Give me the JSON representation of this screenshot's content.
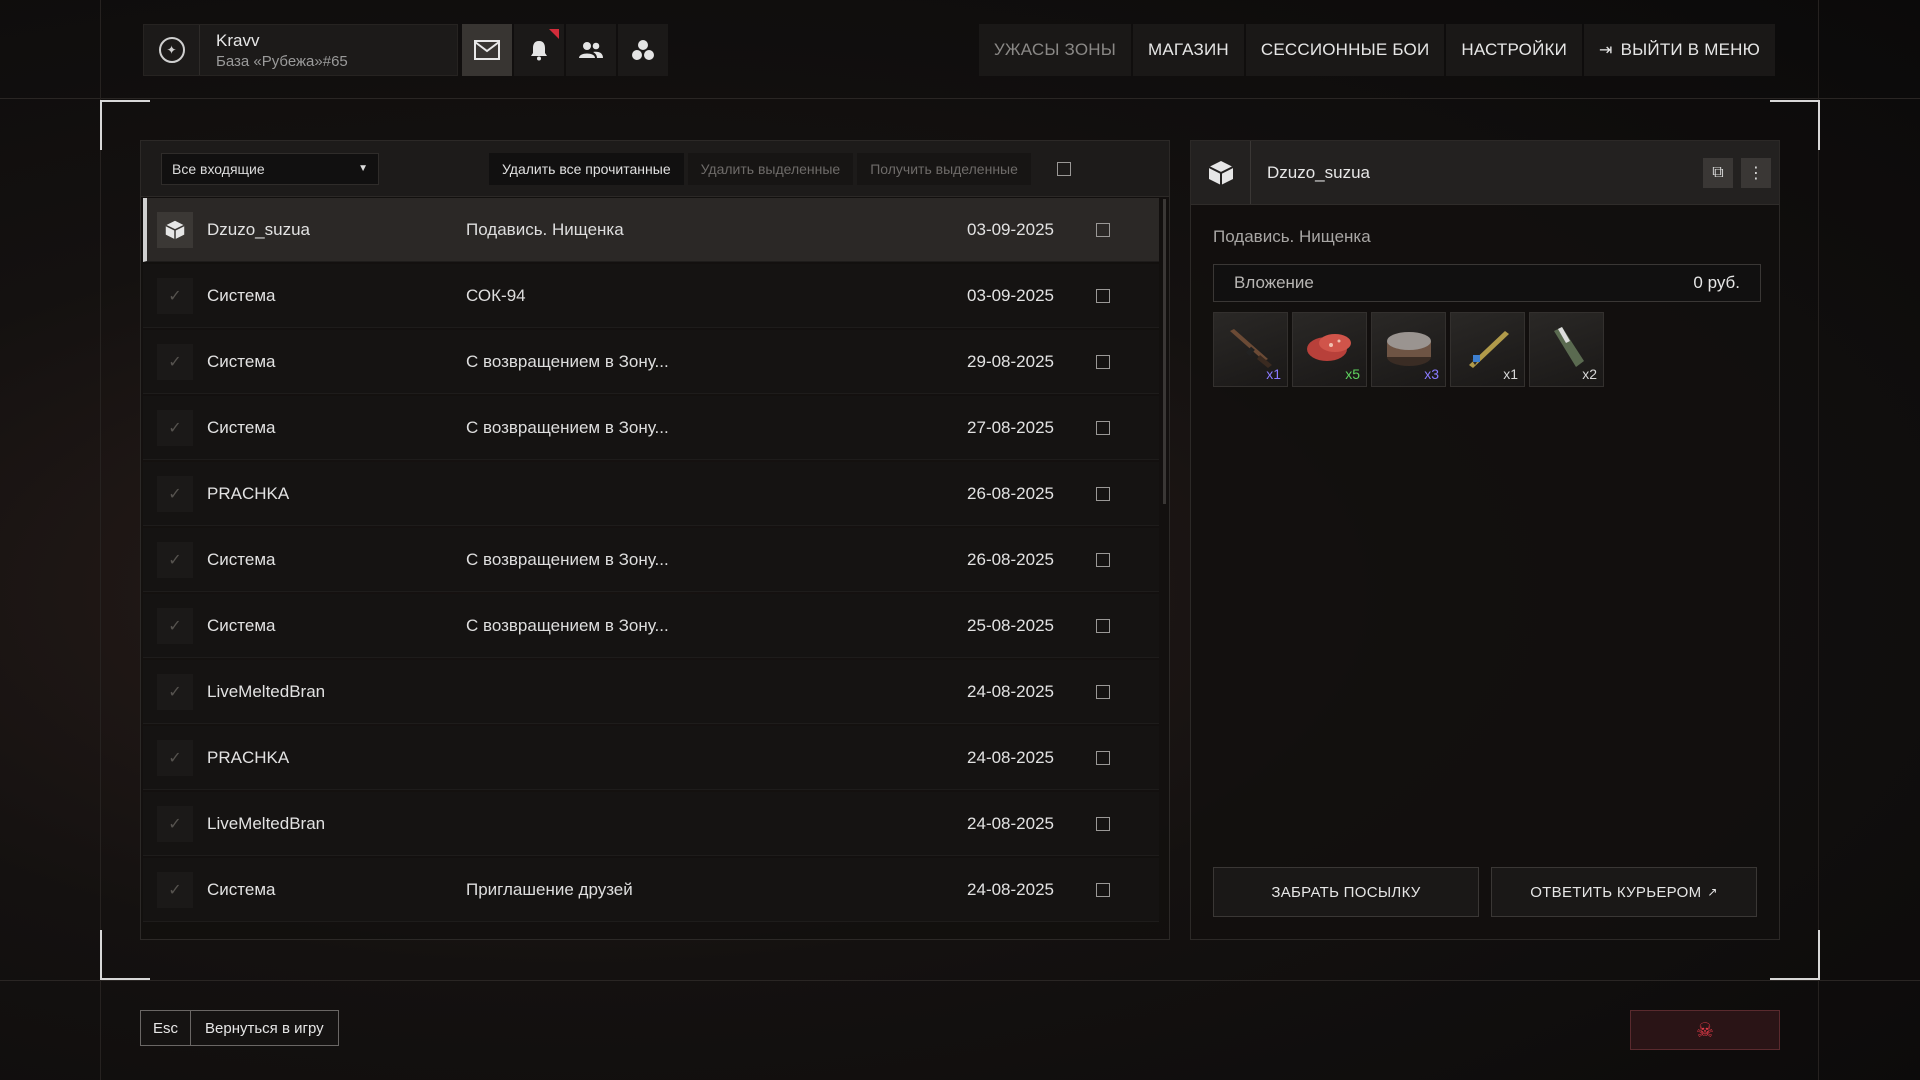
{
  "profile": {
    "nickname": "Kravv",
    "base": "База «Рубежа»#65"
  },
  "top_icons": [
    {
      "name": "mail-icon",
      "active": true
    },
    {
      "name": "bell-icon",
      "notification": true
    },
    {
      "name": "friends-icon"
    },
    {
      "name": "group-icon"
    }
  ],
  "nav": {
    "horrors": "УЖАСЫ ЗОНЫ",
    "shop": "МАГАЗИН",
    "sessions": "СЕССИОННЫЕ БОИ",
    "settings": "НАСТРОЙКИ",
    "exit": "ВЫЙТИ В МЕНЮ"
  },
  "toolbar": {
    "filter": "Все входящие",
    "delete_read": "Удалить все прочитанные",
    "delete_selected": "Удалить выделенные",
    "receive_selected": "Получить выделенные"
  },
  "mails": [
    {
      "sender": "Dzuzo_suzua",
      "subject": "Подавись. Нищенка",
      "date": "03-09-2025",
      "icon": "package-icon"
    },
    {
      "sender": "Система",
      "subject": "СОК-94",
      "date": "03-09-2025",
      "icon": "check-icon"
    },
    {
      "sender": "Система",
      "subject": "С возвращением в Зону...",
      "date": "29-08-2025",
      "icon": "check-icon"
    },
    {
      "sender": "Система",
      "subject": "С возвращением в Зону...",
      "date": "27-08-2025",
      "icon": "check-icon"
    },
    {
      "sender": "PRACHKA",
      "subject": "",
      "date": "26-08-2025",
      "icon": "check-icon"
    },
    {
      "sender": "Система",
      "subject": "С возвращением в Зону...",
      "date": "26-08-2025",
      "icon": "check-icon"
    },
    {
      "sender": "Система",
      "subject": "С возвращением в Зону...",
      "date": "25-08-2025",
      "icon": "check-icon"
    },
    {
      "sender": "LiveMeltedBran",
      "subject": "",
      "date": "24-08-2025",
      "icon": "check-icon"
    },
    {
      "sender": "PRACHKA",
      "subject": "",
      "date": "24-08-2025",
      "icon": "check-icon"
    },
    {
      "sender": "LiveMeltedBran",
      "subject": "",
      "date": "24-08-2025",
      "icon": "check-icon"
    },
    {
      "sender": "Система",
      "subject": "Приглашение друзей",
      "date": "24-08-2025",
      "icon": "check-icon"
    }
  ],
  "detail": {
    "sender": "Dzuzo_suzua",
    "subject": "Подавись. Нищенка",
    "attachment_label": "Вложение",
    "attachment_price": "0 руб.",
    "items": [
      {
        "name": "rifle-item",
        "count": "x1",
        "count_color": "#8a7bff"
      },
      {
        "name": "sausage-item",
        "count": "x5",
        "count_color": "#5fd35f"
      },
      {
        "name": "canned-food-item",
        "count": "x3",
        "count_color": "#8a7bff"
      },
      {
        "name": "bayonet-item",
        "count": "x1",
        "count_color": "#d8d8d8"
      },
      {
        "name": "bottle-item",
        "count": "x2",
        "count_color": "#d8d8d8"
      }
    ],
    "take_parcel": "ЗАБРАТЬ ПОСЫЛКУ",
    "reply_courier": "ОТВЕТИТЬ КУРЬЕРОМ"
  },
  "bottom": {
    "esc_key": "Esc",
    "back_to_game": "Вернуться в игру"
  }
}
